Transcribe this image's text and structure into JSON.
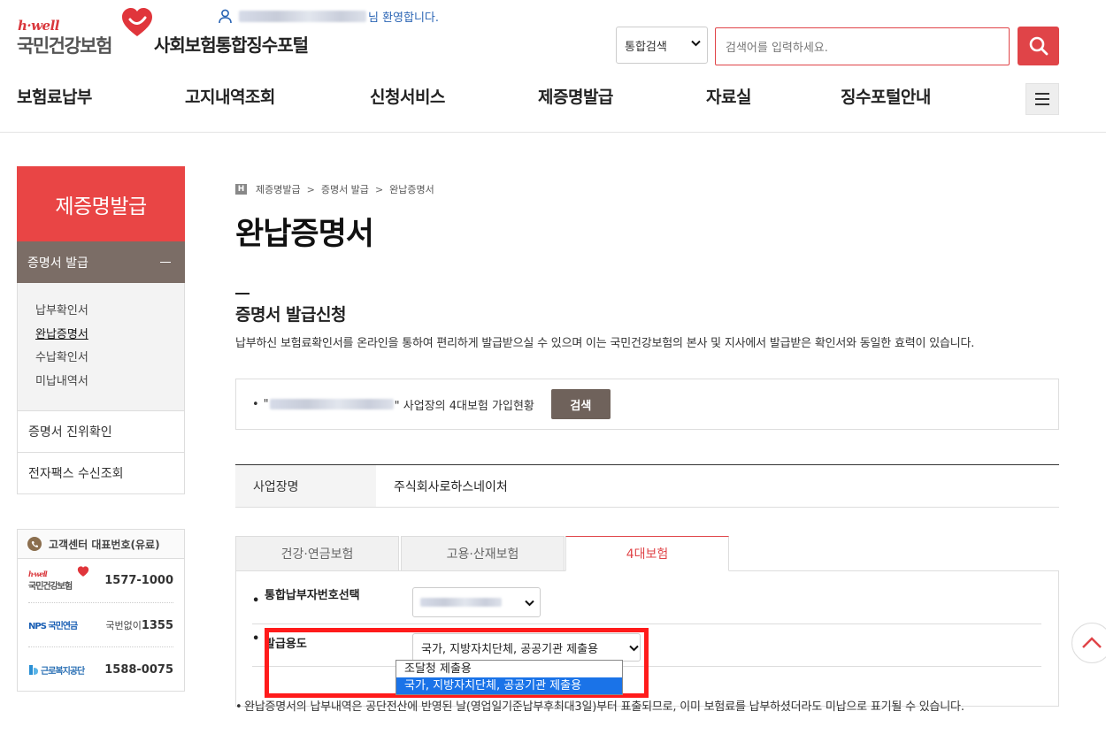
{
  "header": {
    "logo_hwell": "h·well",
    "logo_name": "국민건강보험",
    "portal_name": "사회보험통합징수포털",
    "welcome_suffix": "님 환영합니다.",
    "search_scope": "통합검색",
    "search_placeholder": "검색어를 입력하세요."
  },
  "gnb": [
    "보험료납부",
    "고지내역조회",
    "신청서비스",
    "제증명발급",
    "자료실",
    "징수포털안내"
  ],
  "sidebar": {
    "title": "제증명발급",
    "current_group": "증명서 발급",
    "sub_items": [
      "납부확인서",
      "완납증명서",
      "수납확인서",
      "미납내역서"
    ],
    "items": [
      "증명서 진위확인",
      "전자팩스 수신조회"
    ],
    "customer_center": {
      "title": "고객센터 대표번호(유료)",
      "rows": [
        {
          "logo": "국민건강보험",
          "logo_prefix": "h·well",
          "number": "1577-1000"
        },
        {
          "logo": "NPS 국민연금",
          "prefix": "국번없이",
          "number": "1355"
        },
        {
          "logo": "근로복지공단",
          "number": "1588-0075"
        }
      ]
    }
  },
  "content": {
    "breadcrumb_home": "H",
    "breadcrumb": [
      "제증명발급",
      "증명서 발급",
      "완납증명서"
    ],
    "page_title": "완납증명서",
    "section_title": "증명서 발급신청",
    "section_desc": "납부하신 보험료확인서를 온라인을 통하여 편리하게 발급받으실 수 있으며 이는 국민건강보험의 본사 및 지사에서 발급받은 확인서와 동일한 효력이 있습니다.",
    "status_bullet": "•",
    "status_open_quote": "\"",
    "status_text": "\" 사업장의 4대보험 가입현황",
    "status_button": "검색",
    "table": {
      "label": "사업장명",
      "value": "주식회사로하스네이처"
    },
    "tabs": [
      "건강·연금보험",
      "고용·산재보험",
      "4대보험"
    ],
    "active_tab": "4대보험",
    "form": {
      "field1_label": "통합납부자번호선택",
      "field2_label": "발급용도",
      "field2_value": "국가, 지방자치단체, 공공기관 제출용",
      "options": [
        "조달청 제출용",
        "국가, 지방자치단체, 공공기관 제출용"
      ]
    },
    "note": "완납증명서의 납부내역은 공단전산에 반영된 날(영업일기준납부후최대3일)부터 표출되므로, 이미 보험료를 납부하셨더라도 미납으로 표기될 수 있습니다."
  },
  "colors": {
    "brand_red": "#e94545",
    "sidebar_brown": "#7b6d66",
    "button_brown": "#6f625b",
    "link_blue": "#2a64b4",
    "highlight_red": "#ff1b1b",
    "option_selected_blue": "#1a73e8"
  },
  "icons": [
    "heart-logo-icon",
    "user-icon",
    "chevron-down-icon",
    "search-icon",
    "hamburger-icon",
    "phone-icon",
    "chevron-up-icon"
  ]
}
